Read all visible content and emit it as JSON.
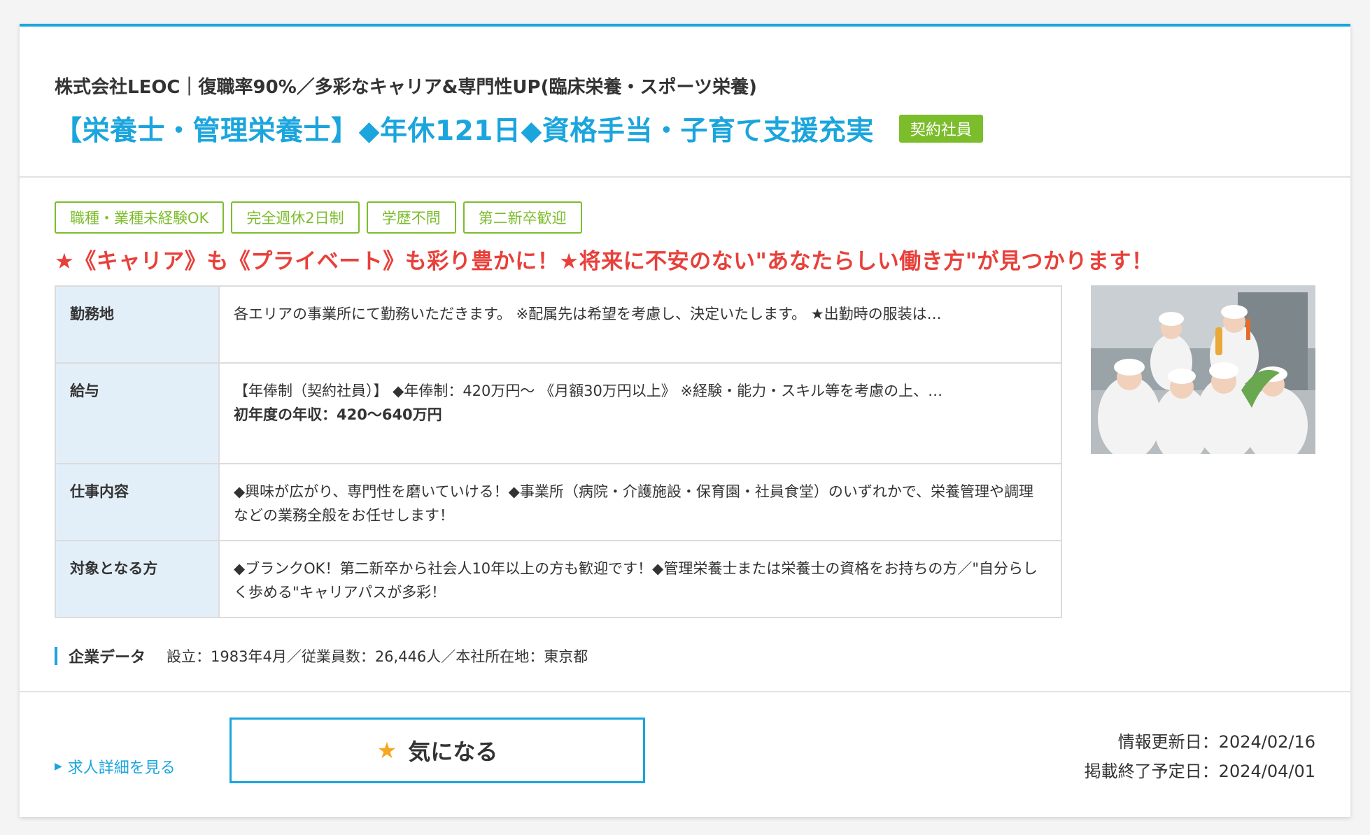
{
  "header": {
    "company": "株式会社LEOC｜復職率90%／多彩なキャリア&専門性UP(臨床栄養・スポーツ栄養)",
    "title": "【栄養士・管理栄養士】◆年休121日◆資格手当・子育て支援充実",
    "employment_type": "契約社員"
  },
  "tags": [
    "職種・業種未経験OK",
    "完全週休2日制",
    "学歴不問",
    "第二新卒歓迎"
  ],
  "catchcopy": "★《キャリア》も《プライベート》も彩り豊かに！★将来に不安のない\"あなたらしい働き方\"が見つかります！",
  "info_rows": [
    {
      "label": "勤務地",
      "value": "各エリアの事業所にて勤務いただきます。 ※配属先は希望を考慮し、決定いたします。 ★出勤時の服装は…",
      "extra": ""
    },
    {
      "label": "給与",
      "value": "【年俸制（契約社員）】 ◆年俸制：420万円〜 《月額30万円以上》 ※経験・能力・スキル等を考慮の上、…",
      "extra": "初年度の年収：420〜640万円"
    },
    {
      "label": "仕事内容",
      "value": "◆興味が広がり、専門性を磨いていける！◆事業所（病院・介護施設・保育園・社員食堂）のいずれかで、栄養管理や調理などの業務全般をお任せします！",
      "extra": ""
    },
    {
      "label": "対象となる方",
      "value": "◆ブランクOK！第二新卒から社会人10年以上の方も歓迎です！◆管理栄養士または栄養士の資格をお持ちの方／\"自分らしく歩める\"キャリアパスが多彩！",
      "extra": ""
    }
  ],
  "corporate": {
    "label": "企業データ",
    "text": "設立：1983年4月／従業員数：26,446人／本社所在地：東京都"
  },
  "footer": {
    "detail_link": "求人詳細を見る",
    "favorite_button": "気になる",
    "updated": "情報更新日：2024/02/16",
    "end_date": "掲載終了予定日：2024/04/01"
  },
  "colors": {
    "accent": "#1aa5dd",
    "green": "#7cbd2c",
    "red": "#e8403a",
    "label_bg": "#e3eff8"
  },
  "icons": {
    "favorite": "star-icon",
    "link": "triangle-right-icon"
  }
}
